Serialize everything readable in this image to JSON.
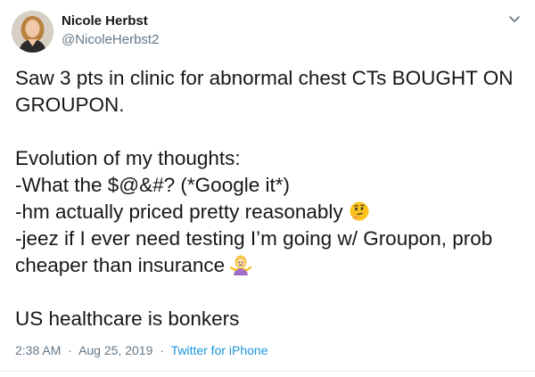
{
  "author": {
    "name": "Nicole Herbst",
    "handle": "@NicoleHerbst2"
  },
  "tweet": {
    "line1": "Saw 3 pts in clinic for abnormal chest CTs BOUGHT ON GROUPON.",
    "line2": "Evolution of my thoughts:",
    "line3": "-What the $@&#? (*Google it*)",
    "line4": "-hm actually priced pretty reasonably",
    "line4_emoji": "thinking-face-icon",
    "line5": "-jeez if I ever need testing I’m going w/ Groupon, prob cheaper than insurance",
    "line5_emoji": "person-shrugging-icon",
    "line6": "US healthcare is bonkers"
  },
  "meta": {
    "time": "2:38 AM",
    "date": "Aug 25, 2019",
    "separator": "·",
    "source": "Twitter for iPhone"
  },
  "icons": {
    "menu": "chevron-down-icon"
  },
  "colors": {
    "text": "#14171a",
    "secondary": "#657786",
    "link": "#1b95e0"
  }
}
